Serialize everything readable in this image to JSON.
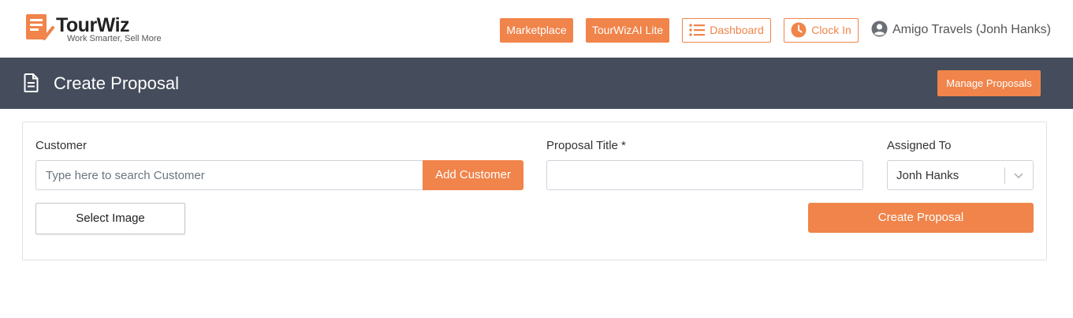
{
  "brand": {
    "name": "TourWiz",
    "tagline": "Work Smarter, Sell More",
    "accent": "#f0844a",
    "header_bg": "#454d5c"
  },
  "nav": {
    "marketplace": "Marketplace",
    "tourwizai": "TourWizAI Lite",
    "dashboard": "Dashboard",
    "clock_in": "Clock In",
    "user": "Amigo Travels (Jonh Hanks)"
  },
  "header": {
    "title": "Create Proposal",
    "manage_label": "Manage Proposals",
    "icon": "document-icon"
  },
  "form": {
    "customer_label": "Customer",
    "customer_placeholder": "Type here to search Customer",
    "customer_value": "",
    "add_customer_label": "Add Customer",
    "title_label": "Proposal Title *",
    "title_value": "",
    "assigned_label": "Assigned To",
    "assigned_value": "Jonh Hanks",
    "select_image_label": "Select Image",
    "create_label": "Create Proposal"
  }
}
